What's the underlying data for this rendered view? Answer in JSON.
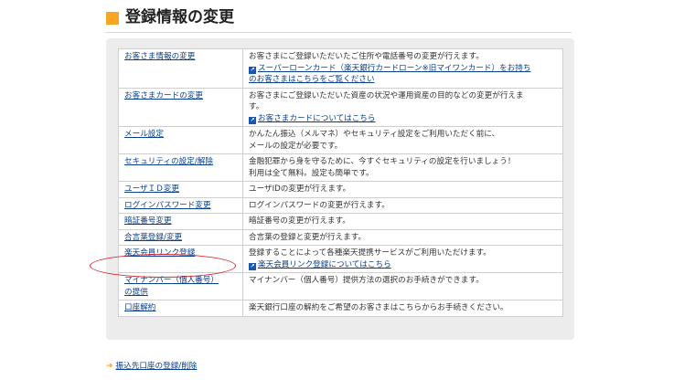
{
  "page": {
    "title": "登録情報の変更",
    "accent_color": "#f5a623",
    "highlight_color": "#d9262c"
  },
  "rows": [
    {
      "label": "お客さま情報の変更",
      "desc": [
        "お客さまにご登録いただいたご住所や電話番号の変更が行えます。"
      ],
      "links": [
        "スーパーローンカード（楽天銀行カードローン※旧マイワンカード）をお持ち",
        "のお客さまはこちらをご覧ください"
      ]
    },
    {
      "label": "お客さまカードの変更",
      "desc": [
        "お客さまにご登録いただいた資産の状況や運用資産の目的などの変更が行えま",
        "す。"
      ],
      "links": [
        "お客さまカードについてはこちら"
      ]
    },
    {
      "label": "メール設定",
      "desc": [
        "かんたん振込（メルマネ）やセキュリティ設定をご利用いただく前に、",
        "メールの設定が必要です。"
      ],
      "links": []
    },
    {
      "label": "セキュリティの設定/解除",
      "desc": [
        "金融犯罪から身を守るために、今すぐセキュリティの設定を行いましょう！",
        "利用は全て無料。設定も簡単です。"
      ],
      "links": []
    },
    {
      "label": "ユーザＩＤ変更",
      "desc": [
        "ユーザIDの変更が行えます。"
      ],
      "links": []
    },
    {
      "label": "ログインパスワード変更",
      "desc": [
        "ログインパスワードの変更が行えます。"
      ],
      "links": []
    },
    {
      "label": "暗証番号変更",
      "desc": [
        "暗証番号の変更が行えます。"
      ],
      "links": []
    },
    {
      "label": "合言葉登録/変更",
      "desc": [
        "合言葉の登録と変更が行えます。"
      ],
      "links": []
    },
    {
      "label": "楽天会員リンク登録",
      "desc": [
        "登録することによって各種楽天提携サービスがご利用いただけます。"
      ],
      "links": [
        "楽天会員リンク登録についてはこちら"
      ]
    },
    {
      "label": [
        "マイナンバー（個人番号）",
        "の提供"
      ],
      "desc": [
        "マイナンバー（個人番号）提供方法の選択のお手続きができます。"
      ],
      "links": []
    },
    {
      "label": "口座解約",
      "desc": [
        "楽天銀行口座の解約をご希望のお客さまはこちらからお手続きください。"
      ],
      "links": []
    }
  ],
  "bottom_link": {
    "label": "振込先口座の登録/削除"
  }
}
